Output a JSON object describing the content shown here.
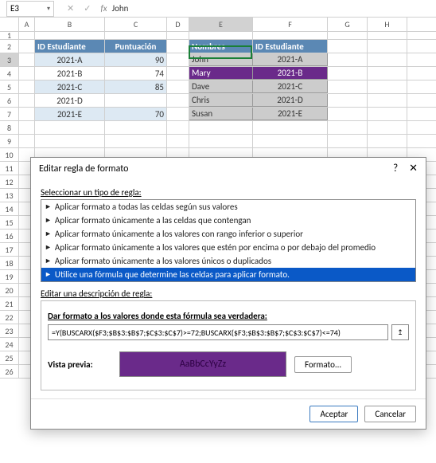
{
  "namebox": "E3",
  "formula_bar": "John",
  "columns": [
    "A",
    "B",
    "C",
    "D",
    "E",
    "F",
    "G",
    "H"
  ],
  "rows_visible": [
    1,
    2,
    3,
    4,
    5,
    6,
    7,
    8,
    9,
    10,
    11,
    12,
    13,
    14,
    15,
    16,
    17,
    18,
    19,
    20,
    21,
    22,
    23,
    24,
    25,
    26
  ],
  "table1": {
    "headers": {
      "id": "ID Estudiante",
      "score": "Puntuación"
    },
    "rows": [
      {
        "id": "2021-A",
        "score": "90"
      },
      {
        "id": "2021-B",
        "score": "74"
      },
      {
        "id": "2021-C",
        "score": "85"
      },
      {
        "id": "2021-D",
        "score": ""
      },
      {
        "id": "2021-E",
        "score": "70"
      }
    ]
  },
  "table2": {
    "headers": {
      "name": "Nombres",
      "id": "ID Estudiante"
    },
    "rows": [
      {
        "name": "John",
        "id": "2021-A",
        "hi": false
      },
      {
        "name": "Mary",
        "id": "2021-B",
        "hi": true
      },
      {
        "name": "Dave",
        "id": "2021-C",
        "hi": false
      },
      {
        "name": "Chris",
        "id": "2021-D",
        "hi": false
      },
      {
        "name": "Susan",
        "id": "2021-E",
        "hi": false
      }
    ]
  },
  "dialog": {
    "title": "Editar regla de formato",
    "help": "?",
    "close": "✕",
    "select_label": "Seleccionar un tipo de regla:",
    "rules": [
      "Aplicar formato a todas las celdas según sus valores",
      "Aplicar formato únicamente a las celdas que contengan",
      "Aplicar formato únicamente a los valores con rango inferior o superior",
      "Aplicar formato únicamente a los valores que estén por encima o por debajo del promedio",
      "Aplicar formato únicamente a los valores únicos o duplicados",
      "Utilice una fórmula que determine las celdas para aplicar formato."
    ],
    "selected_rule_index": 5,
    "desc_label": "Editar una descripción de regla:",
    "formula_label": "Dar formato a los valores donde esta fórmula sea verdadera:",
    "formula_value": "=Y(BUSCARX($F3;$B$3:$B$7;$C$3:$C$7)>=72;BUSCARX($F3;$B$3:$B$7;$C$3:$C$7)<=74)",
    "preview_label": "Vista previa:",
    "preview_sample": "AaBbCcYyZz",
    "format_btn": "Formato...",
    "ok": "Aceptar",
    "cancel": "Cancelar"
  }
}
